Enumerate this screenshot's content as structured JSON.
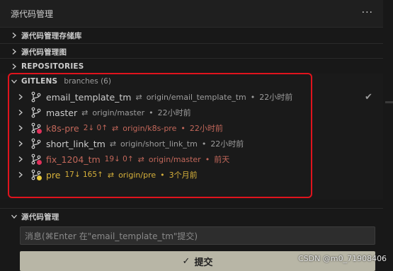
{
  "header": {
    "title": "源代码管理",
    "more": "···"
  },
  "sections": {
    "repos_store": "源代码管理存储库",
    "graph": "源代码管理图",
    "repositories": "REPOSITORIES",
    "gitlens": "GITLENS",
    "gitlens_sub": "branches (6)",
    "scm": "源代码管理"
  },
  "branches": [
    {
      "name": "email_template_tm",
      "counts": "",
      "sync": "⇄",
      "remote": "origin/email_template_tm",
      "dot": "•",
      "time": "22小时前",
      "color": "#cccccc",
      "status_color": "",
      "current": "✔"
    },
    {
      "name": "master",
      "counts": "",
      "sync": "⇄",
      "remote": "origin/master",
      "dot": "•",
      "time": "22小时前",
      "color": "#cccccc",
      "status_color": "",
      "current": ""
    },
    {
      "name": "k8s-pre",
      "counts": "2↓ 0↑",
      "sync": "⇄",
      "remote": "origin/k8s-pre",
      "dot": "•",
      "time": "22小时前",
      "color": "#c2675a",
      "status_color": "#e0305a",
      "current": ""
    },
    {
      "name": "short_link_tm",
      "counts": "",
      "sync": "⇄",
      "remote": "origin/short_link_tm",
      "dot": "•",
      "time": "22小时前",
      "color": "#cccccc",
      "status_color": "",
      "current": ""
    },
    {
      "name": "fix_1204_tm",
      "counts": "19↓ 0↑",
      "sync": "⇄",
      "remote": "origin/master",
      "dot": "•",
      "time": "前天",
      "color": "#c2675a",
      "status_color": "#e0305a",
      "current": ""
    },
    {
      "name": "pre",
      "counts": "17↓ 165↑",
      "sync": "⇄",
      "remote": "origin/pre",
      "dot": "•",
      "time": "3个月前",
      "color": "#d7b13b",
      "status_color": "#e8c83a",
      "current": ""
    }
  ],
  "scm": {
    "placeholder": "消息(⌘Enter 在\"email_template_tm\"提交)",
    "commit_label": "提交",
    "commit_check": "✓"
  },
  "watermark": "CSDN @m0_71908406"
}
